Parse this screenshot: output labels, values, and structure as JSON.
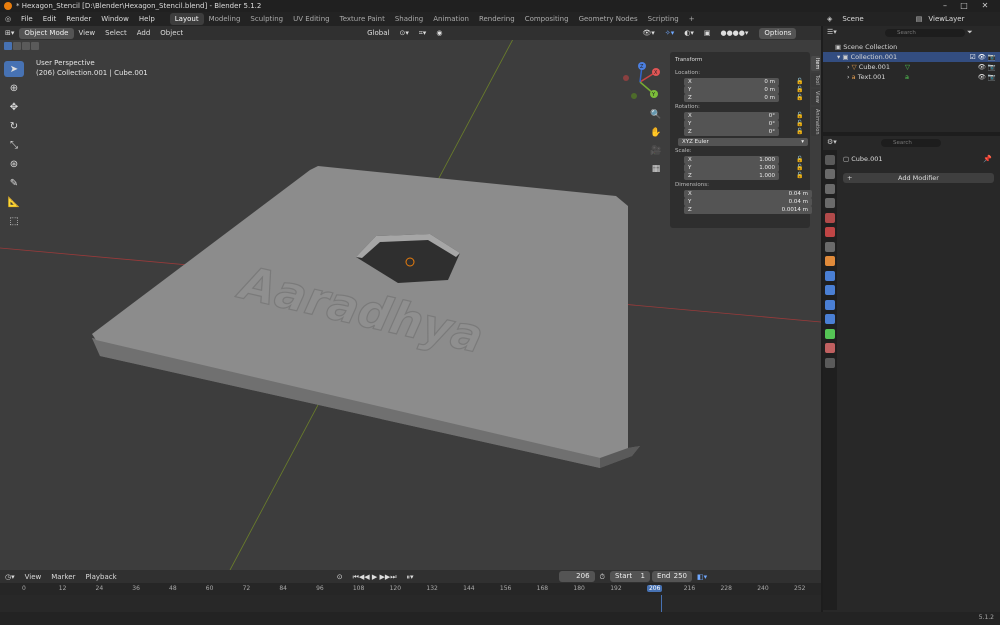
{
  "window": {
    "title": "* Hexagon_Stencil [D:\\Blender\\Hexagon_Stencil.blend] - Blender 5.1.2",
    "controls": [
      "–",
      "□",
      "✕"
    ]
  },
  "menu": [
    "File",
    "Edit",
    "Render",
    "Window",
    "Help"
  ],
  "workspaces": [
    "Layout",
    "Modeling",
    "Sculpting",
    "UV Editing",
    "Texture Paint",
    "Shading",
    "Animation",
    "Rendering",
    "Compositing",
    "Geometry Nodes",
    "Scripting"
  ],
  "active_workspace": "Layout",
  "add_workspace": "+",
  "top_right": {
    "scene": "Scene",
    "view_layer": "ViewLayer"
  },
  "viewport": {
    "mode": "Object Mode",
    "menus": [
      "View",
      "Select",
      "Add",
      "Object"
    ],
    "orientation": "Global",
    "options": "Options",
    "info_line1": "User Perspective",
    "info_line2": "(206) Collection.001 | Cube.001",
    "object_text": "Aaradhya",
    "axis_labels": {
      "x": "X",
      "y": "Y",
      "z": "Z"
    }
  },
  "npanel": {
    "section": "Transform",
    "location_label": "Location:",
    "location": [
      {
        "axis": "X",
        "value": "0 m"
      },
      {
        "axis": "Y",
        "value": "0 m"
      },
      {
        "axis": "Z",
        "value": "0 m"
      }
    ],
    "rotation_label": "Rotation:",
    "rotation": [
      {
        "axis": "X",
        "value": "0°"
      },
      {
        "axis": "Y",
        "value": "0°"
      },
      {
        "axis": "Z",
        "value": "0°"
      }
    ],
    "rotation_mode": "XYZ Euler",
    "scale_label": "Scale:",
    "scale": [
      {
        "axis": "X",
        "value": "1.000"
      },
      {
        "axis": "Y",
        "value": "1.000"
      },
      {
        "axis": "Z",
        "value": "1.000"
      }
    ],
    "dimensions_label": "Dimensions:",
    "dimensions": [
      {
        "axis": "X",
        "value": "0.04 m"
      },
      {
        "axis": "Y",
        "value": "0.04 m"
      },
      {
        "axis": "Z",
        "value": "0.0014 m"
      }
    ],
    "tabs": [
      "Item",
      "Tool",
      "View",
      "Animation"
    ]
  },
  "outliner": {
    "search_placeholder": "Search",
    "items": [
      {
        "label": "Scene Collection"
      },
      {
        "label": "Collection.001"
      },
      {
        "label": "Cube.001"
      },
      {
        "label": "Text.001"
      }
    ]
  },
  "properties": {
    "search_placeholder": "Search",
    "object_name": "Cube.001",
    "add_modifier": "Add Modifier"
  },
  "timeline": {
    "menus": [
      "View",
      "Marker",
      "Playback"
    ],
    "current_frame": "206",
    "start_label": "Start",
    "start": "1",
    "end_label": "End",
    "end": "250",
    "ruler": [
      "0",
      "12",
      "24",
      "36",
      "48",
      "60",
      "72",
      "84",
      "96",
      "108",
      "120",
      "132",
      "144",
      "156",
      "168",
      "180",
      "192",
      "206",
      "216",
      "228",
      "240",
      "252"
    ],
    "current_frame_fraction": 0.82
  },
  "status": {
    "version": "5.1.2"
  },
  "colors": {
    "accent": "#4772b3",
    "select": "#e87d0d",
    "viewport_bg": "#3d3d3d",
    "mesh": "#8a8a8a"
  }
}
